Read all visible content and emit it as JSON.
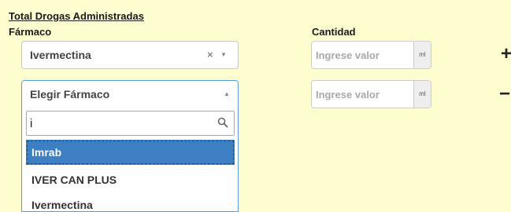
{
  "section": {
    "title": "Total Drogas Administradas",
    "farmaco_label": "Fármaco",
    "cantidad_label": "Cantidad"
  },
  "rows": [
    {
      "farmaco_value": "Ivermectina",
      "clear_icon": "×",
      "arrow_icon": "▼",
      "qty_placeholder": "Ingrese valor",
      "unit": "ml",
      "action": "+"
    },
    {
      "farmaco_value": "Elegir Fármaco",
      "arrow_icon": "▲",
      "qty_placeholder": "Ingrese valor",
      "unit": "ml",
      "action": "−"
    }
  ],
  "dropdown": {
    "search_value": "i",
    "search_icon": "search-icon",
    "options": [
      "Imrab",
      "IVER CAN PLUS",
      "Ivermectina"
    ],
    "highlighted_index": 0
  },
  "colors": {
    "background": "#fefdd0",
    "highlight": "#3c7fc2",
    "focus_border": "#5b9dd9"
  }
}
